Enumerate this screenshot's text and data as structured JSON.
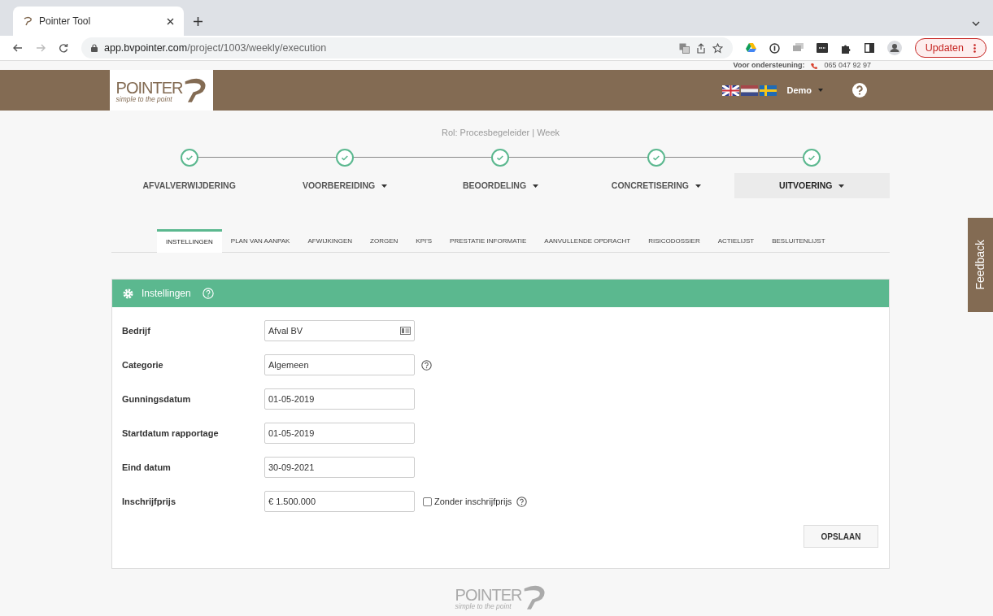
{
  "browser": {
    "tab_title": "Pointer Tool",
    "url_host": "app.bvpointer.com",
    "url_path": "/project/1003/weekly/execution",
    "update_button": "Updaten"
  },
  "support": {
    "label": "Voor ondersteuning:",
    "phone": "065 047 92 97"
  },
  "header": {
    "logo_name": "POINTER",
    "logo_tagline": "simple to the point",
    "user": "Demo"
  },
  "footer": {
    "logo_name": "POINTER",
    "logo_tagline": "simple to the point"
  },
  "role": "Rol: Procesbegeleider | Week",
  "steps": [
    {
      "label": "AFVALVERWIJDERING",
      "completed": true,
      "dropdown": false,
      "selected": false
    },
    {
      "label": "VOORBEREIDING",
      "completed": true,
      "dropdown": true,
      "selected": false
    },
    {
      "label": "BEOORDELING",
      "completed": true,
      "dropdown": true,
      "selected": false
    },
    {
      "label": "CONCRETISERING",
      "completed": true,
      "dropdown": true,
      "selected": false
    },
    {
      "label": "UITVOERING",
      "completed": true,
      "dropdown": true,
      "selected": true
    }
  ],
  "tabs": [
    {
      "label": "INSTELLINGEN",
      "selected": true
    },
    {
      "label": "PLAN VAN AANPAK",
      "selected": false
    },
    {
      "label": "AFWIJKINGEN",
      "selected": false
    },
    {
      "label": "ZORGEN",
      "selected": false
    },
    {
      "label": "KPI'S",
      "selected": false
    },
    {
      "label": "PRESTATIE INFORMATIE",
      "selected": false
    },
    {
      "label": "AANVULLENDE OPDRACHT",
      "selected": false
    },
    {
      "label": "RISICODOSSIER",
      "selected": false
    },
    {
      "label": "ACTIELIJST",
      "selected": false
    },
    {
      "label": "BESLUITENLIJST",
      "selected": false
    }
  ],
  "panel": {
    "title": "Instellingen",
    "fields": [
      {
        "label": "Bedrijf",
        "value": "Afval BV",
        "kind": "lookup",
        "help": false
      },
      {
        "label": "Categorie",
        "value": "Algemeen",
        "kind": "text",
        "help": true
      },
      {
        "label": "Gunningsdatum",
        "value": "01-05-2019",
        "kind": "text",
        "help": false
      },
      {
        "label": "Startdatum rapportage",
        "value": "01-05-2019",
        "kind": "text",
        "help": false
      },
      {
        "label": "Eind datum",
        "value": "30-09-2021",
        "kind": "text",
        "help": false
      },
      {
        "label": "Inschrijfprijs",
        "value": "€ 1.500.000",
        "kind": "text",
        "help": false,
        "checkbox": {
          "label": "Zonder inschrijfprijs",
          "checked": false
        }
      }
    ],
    "save_button": "OPSLAAN"
  },
  "feedback": "Feedback"
}
